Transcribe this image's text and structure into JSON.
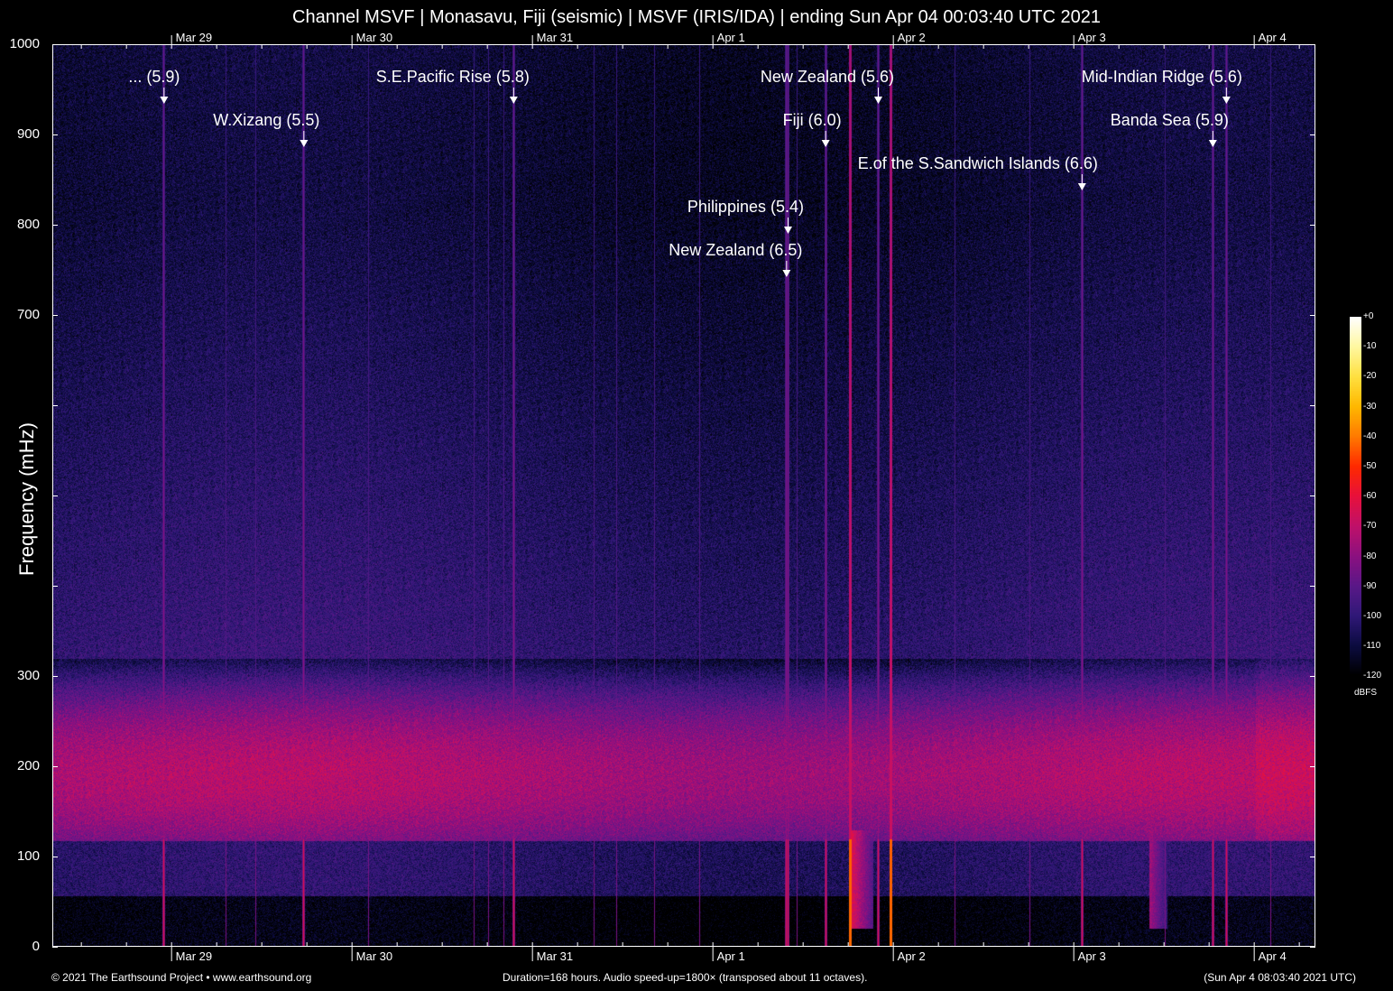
{
  "chart_data": {
    "type": "heatmap",
    "title": "Channel MSVF | Monasavu, Fiji (seismic) | MSVF (IRIS/IDA) | ending Sun Apr 04 00:03:40 UTC 2021",
    "ylabel": "Frequency (mHz)",
    "ylim": [
      0,
      1000
    ],
    "y_tick_labels": [
      {
        "value": 0,
        "label": "0"
      },
      {
        "value": 100,
        "label": "100"
      },
      {
        "value": 200,
        "label": "200"
      },
      {
        "value": 300,
        "label": "300"
      },
      {
        "value": 700,
        "label": "700"
      },
      {
        "value": 800,
        "label": "800"
      },
      {
        "value": 900,
        "label": "900"
      },
      {
        "value": 1000,
        "label": "1000"
      }
    ],
    "x_unit": "hours",
    "xlim": [
      0,
      168
    ],
    "x_tick_labels": [
      {
        "hour": 15.8,
        "label": "Mar 29"
      },
      {
        "hour": 39.8,
        "label": "Mar 30"
      },
      {
        "hour": 63.8,
        "label": "Mar 31"
      },
      {
        "hour": 87.8,
        "label": "Apr  1"
      },
      {
        "hour": 111.8,
        "label": "Apr  2"
      },
      {
        "hour": 135.8,
        "label": "Apr  3"
      },
      {
        "hour": 159.8,
        "label": "Apr  4"
      }
    ],
    "events": [
      {
        "label": "... (5.9)",
        "hour": 14.8
      },
      {
        "label": "W.Xizang (5.5)",
        "hour": 33.4
      },
      {
        "label": "S.E.Pacific Rise (5.8)",
        "hour": 61.3
      },
      {
        "label": "New Zealand (5.6)",
        "hour": 109.8
      },
      {
        "label": "Fiji (6.0)",
        "hour": 102.8
      },
      {
        "label": "E.of the S.Sandwich Islands (6.6)",
        "hour": 136.9
      },
      {
        "label": "Philippines (5.4)",
        "hour": 97.8
      },
      {
        "label": "New Zealand (6.5)",
        "hour": 97.6
      },
      {
        "label": "Mid-Indian Ridge (5.6)",
        "hour": 156.1
      },
      {
        "label": "Banda Sea (5.9)",
        "hour": 154.3
      }
    ],
    "colorbar": {
      "unit": "dBFS",
      "range": [
        -120,
        0
      ],
      "ticks": [
        "+0",
        "-10",
        "-20",
        "-30",
        "-40",
        "-50",
        "-60",
        "-70",
        "-80",
        "-90",
        "-100",
        "-110",
        "-120"
      ],
      "colors": [
        "#000000",
        "#0c0c40",
        "#301878",
        "#5a1888",
        "#8c1080",
        "#c0106a",
        "#e8103c",
        "#ff2a00",
        "#ff7a00",
        "#ffb800",
        "#ffe040",
        "#fff8a0",
        "#ffffff"
      ]
    }
  },
  "footer": {
    "copyright": "© 2021 The Earthsound Project • www.earthsound.org",
    "duration": "Duration=168 hours. Audio speed-up=1800× (transposed about 11 octaves).",
    "end_time": "(Sun Apr  4 08:03:40 2021 UTC)"
  }
}
